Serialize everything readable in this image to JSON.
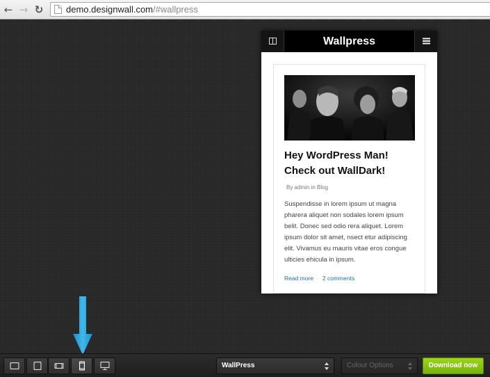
{
  "browser": {
    "url_host": "demo.designwall.com",
    "url_path": "/#wallpress"
  },
  "preview": {
    "brand": "Wallpress",
    "post": {
      "title": "Hey WordPress Man! Check out WallDark!",
      "meta": "By admin in Blog",
      "excerpt": "Suspendisse in lorem ipsum ut magna pharera aliquet non sodales lorem ipsum belit. Donec sed odio rera aliquet. Lorem ipsum dolor sit amet, nsect etur adipiscing elit. Vivamus eu mauris vitae eros congue ulticies ehicula in ipsum.",
      "read_more": "Read more",
      "separator": "·",
      "comments": "2 comments"
    }
  },
  "toolbar": {
    "devices": [
      "tablet-landscape-icon",
      "tablet-portrait-icon",
      "phone-landscape-icon",
      "phone-portrait-icon",
      "desktop-icon"
    ],
    "active_device": "phone-portrait-icon",
    "theme_select": "WallPress",
    "colour_select": "Colour Options",
    "download_label": "Download now"
  },
  "colors": {
    "accent": "#8cc615",
    "arrow": "#2aa7e0",
    "link": "#1f6fb5"
  }
}
